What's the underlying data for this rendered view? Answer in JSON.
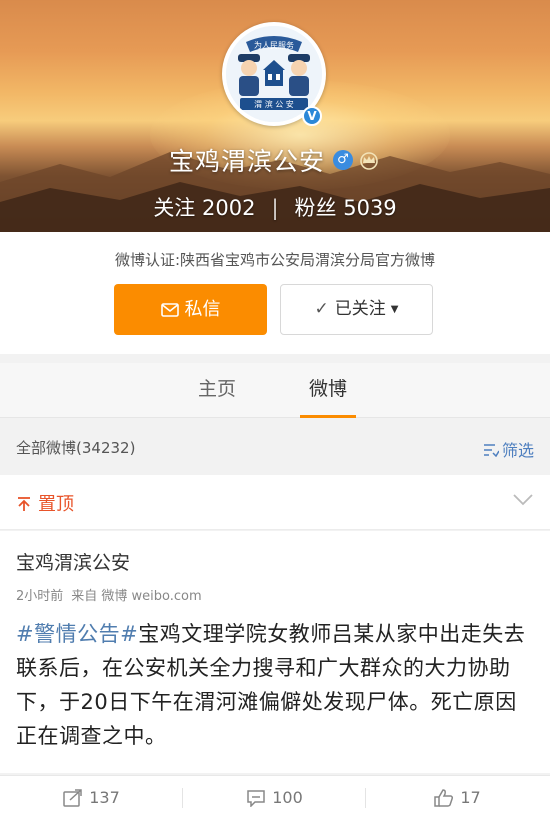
{
  "profile": {
    "name": "宝鸡渭滨公安",
    "following_label": "关注",
    "following_count": "2002",
    "followers_label": "粉丝",
    "followers_count": "5039",
    "verification": "微博认证:陕西省宝鸡市公安局渭滨分局官方微博",
    "avatar_text_top": "为人民服务",
    "avatar_text_bottom": "渭 滨 公 安",
    "gender_icon": "male-icon",
    "badge_icon": "crown-icon"
  },
  "actions": {
    "message_label": "私信",
    "follow_label": "已关注"
  },
  "tabs": [
    {
      "label": "主页"
    },
    {
      "label": "微博"
    }
  ],
  "filter": {
    "all_label": "全部微博(34232)",
    "filter_label": "筛选"
  },
  "pinned": {
    "label": "置顶"
  },
  "post": {
    "author": "宝鸡渭滨公安",
    "time": "2小时前",
    "source": "来自 微博 weibo.com",
    "topic": "#警情公告#",
    "text": "宝鸡文理学院女教师吕某从家中出走失去联系后，在公安机关全力搜寻和广大群众的大力协助下，于20日下午在渭河滩偏僻处发现尸体。死亡原因正在调查之中。",
    "reposts": "137",
    "comments": "100",
    "likes": "17"
  },
  "colors": {
    "accent": "#fb8c00",
    "topic_link": "#507daf",
    "pinned": "#e8542a",
    "verified": "#2b88d8"
  }
}
